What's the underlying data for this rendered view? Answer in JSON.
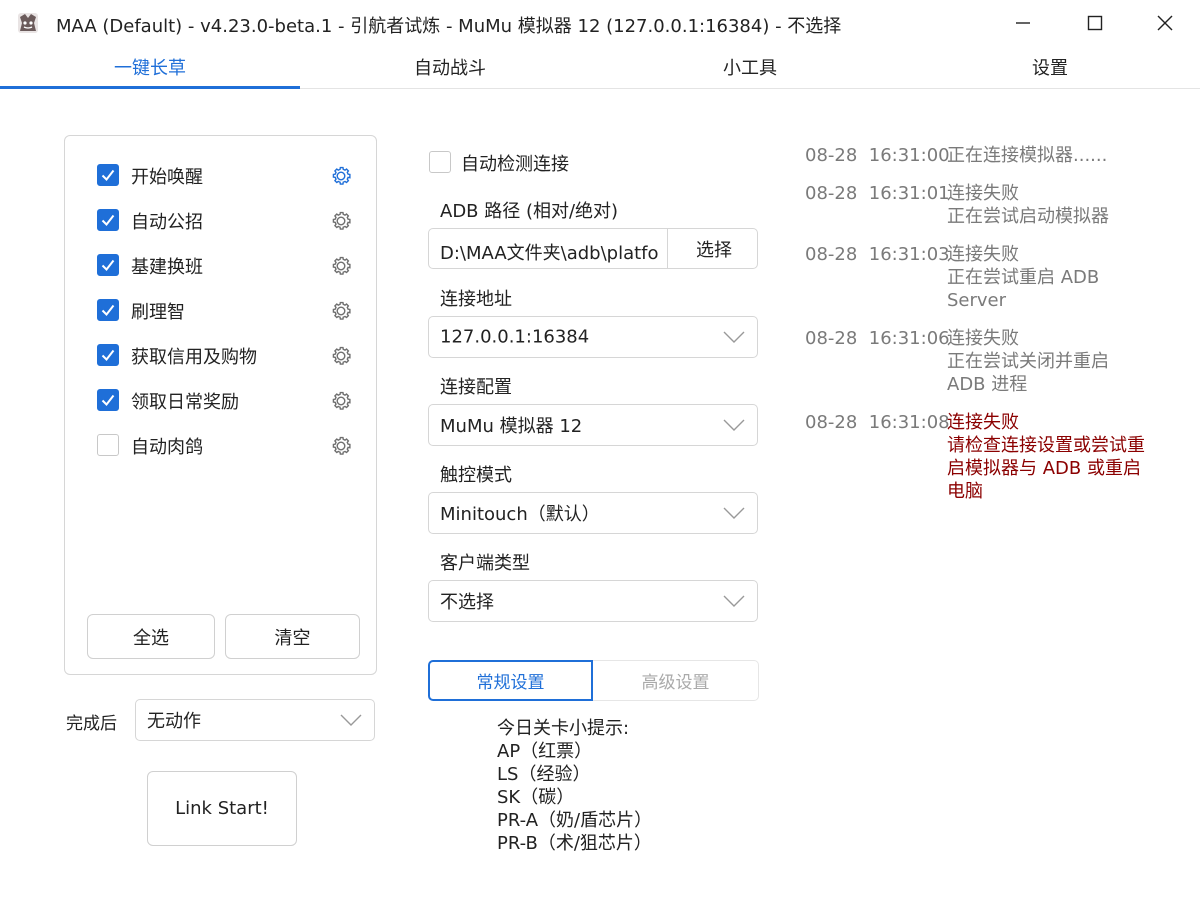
{
  "window": {
    "title": "MAA (Default) - v4.23.0-beta.1 - 引航者试炼 - MuMu 模拟器 12 (127.0.0.1:16384) - 不选择"
  },
  "tabs": [
    {
      "label": "一键长草",
      "active": true
    },
    {
      "label": "自动战斗",
      "active": false
    },
    {
      "label": "小工具",
      "active": false
    },
    {
      "label": "设置",
      "active": false
    }
  ],
  "tasks": [
    {
      "label": "开始唤醒",
      "checked": true
    },
    {
      "label": "自动公招",
      "checked": true
    },
    {
      "label": "基建换班",
      "checked": true
    },
    {
      "label": "刷理智",
      "checked": true
    },
    {
      "label": "获取信用及购物",
      "checked": true
    },
    {
      "label": "领取日常奖励",
      "checked": true
    },
    {
      "label": "自动肉鸽",
      "checked": false
    }
  ],
  "task_buttons": {
    "select_all": "全选",
    "clear": "清空"
  },
  "after_complete": {
    "label": "完成后",
    "value": "无动作"
  },
  "start_button": "Link Start!",
  "connection": {
    "auto_detect_label": "自动检测连接",
    "auto_detect_checked": false,
    "adb_path_label": "ADB 路径 (相对/绝对)",
    "adb_path_value": "D:\\MAA文件夹\\adb\\platfo",
    "adb_select_button": "选择",
    "address_label": "连接地址",
    "address_value": "127.0.0.1:16384",
    "config_label": "连接配置",
    "config_value": "MuMu 模拟器 12",
    "touch_label": "触控模式",
    "touch_value": "Minitouch（默认）",
    "client_label": "客户端类型",
    "client_value": "不选择"
  },
  "settings_tabs": {
    "normal": "常规设置",
    "advanced": "高级设置"
  },
  "tips": {
    "title": "今日关卡小提示:",
    "lines": [
      "AP（红票）",
      "LS（经验）",
      "SK（碳）",
      "PR-A（奶/盾芯片）",
      "PR-B（术/狙芯片）"
    ]
  },
  "log": [
    {
      "date": "08-28",
      "time": "16:31:00",
      "message": "正在连接模拟器......",
      "error": false
    },
    {
      "date": "08-28",
      "time": "16:31:01",
      "message": "连接失败\n正在尝试启动模拟器",
      "error": false
    },
    {
      "date": "08-28",
      "time": "16:31:03",
      "message": "连接失败\n正在尝试重启 ADB Server",
      "error": false
    },
    {
      "date": "08-28",
      "time": "16:31:06",
      "message": "连接失败\n正在尝试关闭并重启 ADB 进程",
      "error": false
    },
    {
      "date": "08-28",
      "time": "16:31:08",
      "message": "连接失败\n请检查连接设置或尝试重启模拟器与 ADB 或重启电脑",
      "error": true
    }
  ],
  "colors": {
    "accent": "#1f6fd8",
    "error": "#8b0000",
    "log_gray": "#7a7a7a"
  }
}
